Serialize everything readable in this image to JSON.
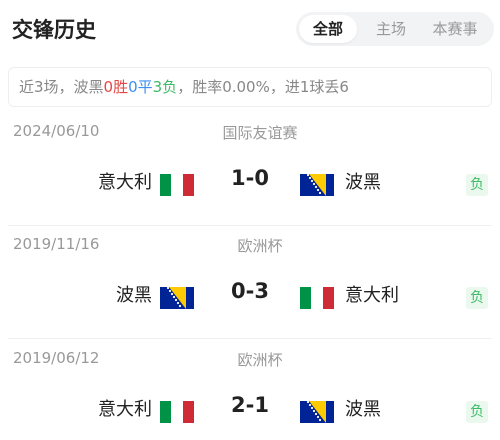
{
  "header": {
    "title": "交锋历史",
    "tabs": [
      {
        "label": "全部",
        "active": true
      },
      {
        "label": "主场",
        "active": false
      },
      {
        "label": "本赛事",
        "active": false
      }
    ]
  },
  "summary": {
    "prefix": "近3场，波黑",
    "wins": "0胜",
    "draws": "0平",
    "losses": "3负",
    "suffix": "，胜率0.00%，进1球丢6"
  },
  "colors": {
    "win": "#e54545",
    "draw": "#3d8ff0",
    "loss": "#3dbb67"
  },
  "matches": [
    {
      "date": "2024/06/10",
      "competition": "国际友谊赛",
      "home": "意大利",
      "home_flag": "italy-flag",
      "score": "1-0",
      "away": "波黑",
      "away_flag": "bosnia-flag",
      "result": "负"
    },
    {
      "date": "2019/11/16",
      "competition": "欧洲杯",
      "home": "波黑",
      "home_flag": "bosnia-flag",
      "score": "0-3",
      "away": "意大利",
      "away_flag": "italy-flag",
      "result": "负"
    },
    {
      "date": "2019/06/12",
      "competition": "欧洲杯",
      "home": "意大利",
      "home_flag": "italy-flag",
      "score": "2-1",
      "away": "波黑",
      "away_flag": "bosnia-flag",
      "result": "负"
    }
  ]
}
